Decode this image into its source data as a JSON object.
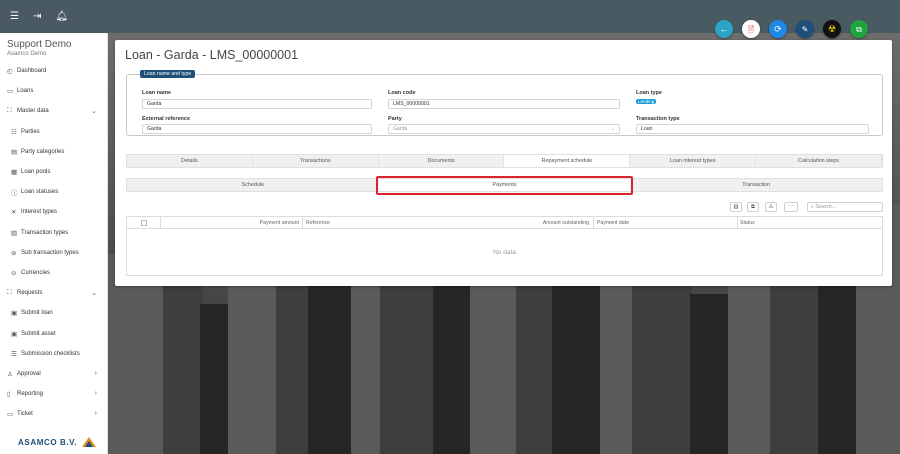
{
  "topbar": {
    "icons": [
      "menu-icon",
      "logout-icon",
      "bell-icon"
    ]
  },
  "sidebar": {
    "app_title": "Support Demo",
    "app_subtitle": "Asamco Demo",
    "items": [
      {
        "label": "Dashboard",
        "icon": "dashboard-icon"
      },
      {
        "label": "Loans",
        "icon": "loans-icon"
      },
      {
        "label": "Master data",
        "icon": "master-data-icon"
      },
      {
        "label": "Parties",
        "icon": "parties-icon"
      },
      {
        "label": "Party categories",
        "icon": "party-categories-icon"
      },
      {
        "label": "Loan pools",
        "icon": "loan-pools-icon"
      },
      {
        "label": "Loan statuses",
        "icon": "loan-statuses-icon"
      },
      {
        "label": "Interest types",
        "icon": "interest-types-icon"
      },
      {
        "label": "Transaction types",
        "icon": "transaction-types-icon"
      },
      {
        "label": "Sub transaction types",
        "icon": "sub-transaction-types-icon"
      },
      {
        "label": "Currencies",
        "icon": "currencies-icon"
      },
      {
        "label": "Requests",
        "icon": "requests-icon"
      },
      {
        "label": "Submit loan",
        "icon": "submit-loan-icon"
      },
      {
        "label": "Submit asset",
        "icon": "submit-asset-icon"
      },
      {
        "label": "Submission checklists",
        "icon": "checklist-icon"
      },
      {
        "label": "Approval",
        "icon": "approval-icon"
      },
      {
        "label": "Reporting",
        "icon": "reporting-icon"
      },
      {
        "label": "Ticket",
        "icon": "ticket-icon"
      }
    ],
    "logo_text": "ASAMCO B.V."
  },
  "fabs": [
    {
      "icon": "back-arrow-icon",
      "color": "#2aa3c7"
    },
    {
      "icon": "pdf-icon",
      "color": "#ffffff"
    },
    {
      "icon": "refresh-icon",
      "color": "#1e88e5"
    },
    {
      "icon": "edit-icon",
      "color": "#1f4e79"
    },
    {
      "icon": "hazard-icon",
      "color": "#111111"
    },
    {
      "icon": "copy-icon",
      "color": "#21a33f"
    }
  ],
  "page": {
    "title": "Loan - Garda - LMS_00000001",
    "legend": "Loan name and type",
    "fields": {
      "loan_name_label": "Loan name",
      "loan_name_value": "Garda",
      "loan_code_label": "Loan code",
      "loan_code_value": "LMS_00000001",
      "loan_type_label": "Loan type",
      "loan_type_value": "Lending",
      "external_reference_label": "External reference",
      "external_reference_value": "Garda",
      "party_label": "Party",
      "party_value": "Garda",
      "transaction_type_label": "Transaction type",
      "transaction_type_value": "Loan"
    },
    "tabs": [
      "Details",
      "Transactions",
      "Documents",
      "Repayment schedule",
      "Loan interest types",
      "Calculation steps"
    ],
    "active_tab": "Repayment schedule",
    "subtabs": [
      "Schedule",
      "Payments",
      "Transaction"
    ],
    "active_subtab": "Payments",
    "search_placeholder": "Search...",
    "grid_columns": [
      "Payment amount",
      "Reference",
      "Amount outstanding",
      "Payment date",
      "Status"
    ],
    "no_data": "No data"
  },
  "colors": {
    "accent": "#1f4e79",
    "highlight": "#d9262c",
    "topbar": "#4a5a63"
  }
}
